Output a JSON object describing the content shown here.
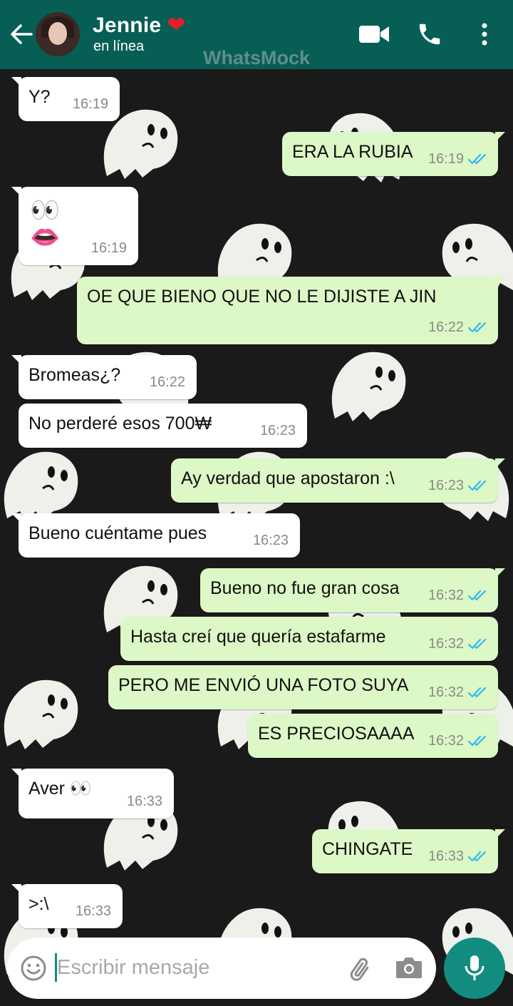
{
  "header": {
    "contact_name": "Jennie",
    "heart": "❤",
    "status": "en línea",
    "watermark": "WhatsMock",
    "icons": [
      "back-arrow-icon",
      "video-call-icon",
      "phone-icon",
      "more-options-icon"
    ]
  },
  "messages": [
    {
      "dir": "in",
      "text": "Y?",
      "time": "16:19"
    },
    {
      "dir": "out",
      "text": "ERA LA RUBIA",
      "time": "16:19",
      "read": true
    },
    {
      "dir": "in",
      "text": "👀\n👄",
      "time": "16:19"
    },
    {
      "dir": "out",
      "text": "OE QUE BIENO QUE NO LE DIJISTE A JIN",
      "time": "16:22",
      "read": true
    },
    {
      "dir": "in",
      "text": "Bromeas¿?",
      "time": "16:22"
    },
    {
      "dir": "in",
      "text": "No perderé esos 700₩",
      "time": "16:23"
    },
    {
      "dir": "out",
      "text": "Ay verdad que apostaron :\\",
      "time": "16:23",
      "read": true
    },
    {
      "dir": "in",
      "text": "Bueno cuéntame pues",
      "time": "16:23"
    },
    {
      "dir": "out",
      "text": "Bueno no fue gran cosa",
      "time": "16:32",
      "read": true
    },
    {
      "dir": "out",
      "text": "Hasta creí que quería estafarme",
      "time": "16:32",
      "read": true
    },
    {
      "dir": "out",
      "text": "PERO ME ENVIÓ UNA FOTO SUYA",
      "time": "16:32",
      "read": true
    },
    {
      "dir": "out",
      "text": "ES PRECIOSAAAA",
      "time": "16:32",
      "read": true
    },
    {
      "dir": "in",
      "text": "Aver 👀",
      "time": "16:33"
    },
    {
      "dir": "out",
      "text": "CHINGATE",
      "time": "16:33",
      "read": true
    },
    {
      "dir": "in",
      "text": ">:\\",
      "time": "16:33"
    }
  ],
  "input": {
    "placeholder": "Escribir mensaje",
    "icons": [
      "emoji-icon",
      "attach-icon",
      "camera-icon",
      "microphone-icon"
    ]
  },
  "colors": {
    "header": "#075e54",
    "outgoing_bubble": "#dcf8c6",
    "incoming_bubble": "#ffffff",
    "read_ticks": "#34b7f1",
    "mic_button": "#128c7e"
  }
}
